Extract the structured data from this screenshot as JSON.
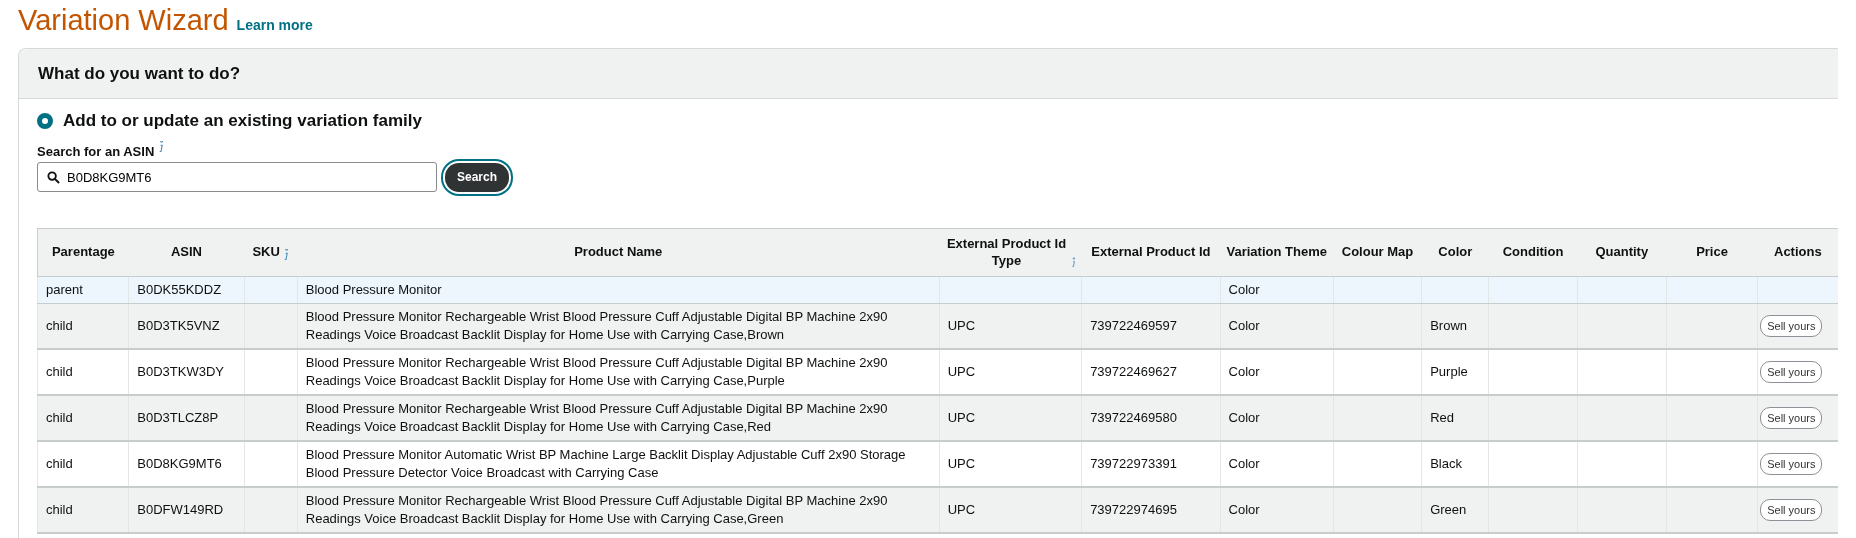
{
  "page": {
    "title": "Variation Wizard",
    "learn_more": "Learn more"
  },
  "panel": {
    "heading": "What do you want to do?"
  },
  "option": {
    "label": "Add to or update an existing variation family",
    "selected": true
  },
  "search": {
    "label": "Search for an ASIN",
    "value": "B0D8KG9MT6",
    "button": "Search",
    "button_focused": true
  },
  "table": {
    "columns": [
      {
        "label": "Parentage",
        "info": false
      },
      {
        "label": "ASIN",
        "info": false
      },
      {
        "label": "SKU",
        "info": true
      },
      {
        "label": "Product Name",
        "info": false
      },
      {
        "label": "External Product Id Type",
        "info": true
      },
      {
        "label": "External Product Id",
        "info": false
      },
      {
        "label": "Variation Theme",
        "info": false
      },
      {
        "label": "Colour Map",
        "info": false
      },
      {
        "label": "Color",
        "info": false
      },
      {
        "label": "Condition",
        "info": false
      },
      {
        "label": "Quantity",
        "info": false
      },
      {
        "label": "Price",
        "info": false
      },
      {
        "label": "Actions",
        "info": false
      }
    ],
    "rows": [
      {
        "highlighted": true,
        "parentage": "parent",
        "asin": "B0DK55KDDZ",
        "product_name": "Blood Pressure Monitor",
        "variation_theme": "Color"
      },
      {
        "highlighted": false,
        "parentage": "child",
        "asin": "B0D3TK5VNZ",
        "product_name": "Blood Pressure Monitor Rechargeable Wrist Blood Pressure Cuff Adjustable Digital BP Machine 2x90 Readings Voice Broadcast Backlit Display for Home Use with Carrying Case,Brown",
        "id_type": "UPC",
        "product_id": "739722469597",
        "variation_theme": "Color",
        "color_name": "Brown",
        "action": "Sell yours"
      },
      {
        "highlighted": false,
        "parentage": "child",
        "asin": "B0D3TKW3DY",
        "product_name": "Blood Pressure Monitor Rechargeable Wrist Blood Pressure Cuff Adjustable Digital BP Machine 2x90 Readings Voice Broadcast Backlit Display for Home Use with Carrying Case,Purple",
        "id_type": "UPC",
        "product_id": "739722469627",
        "variation_theme": "Color",
        "color_name": "Purple",
        "action": "Sell yours"
      },
      {
        "highlighted": false,
        "parentage": "child",
        "asin": "B0D3TLCZ8P",
        "product_name": "Blood Pressure Monitor Rechargeable Wrist Blood Pressure Cuff Adjustable Digital BP Machine 2x90 Readings Voice Broadcast Backlit Display for Home Use with Carrying Case,Red",
        "id_type": "UPC",
        "product_id": "739722469580",
        "variation_theme": "Color",
        "color_name": "Red",
        "action": "Sell yours"
      },
      {
        "highlighted": false,
        "parentage": "child",
        "asin": "B0D8KG9MT6",
        "product_name": "Blood Pressure Monitor Automatic Wrist BP Machine Large Backlit Display Adjustable Cuff 2x90 Storage Blood Pressure Detector Voice Broadcast with Carrying Case",
        "id_type": "UPC",
        "product_id": "739722973391",
        "variation_theme": "Color",
        "color_name": "Black",
        "action": "Sell yours"
      },
      {
        "highlighted": false,
        "parentage": "child",
        "asin": "B0DFW149RD",
        "product_name": "Blood Pressure Monitor Rechargeable Wrist Blood Pressure Cuff Adjustable Digital BP Machine 2x90 Readings Voice Broadcast Backlit Display for Home Use with Carrying Case,Green",
        "id_type": "UPC",
        "product_id": "739722974695",
        "variation_theme": "Color",
        "color_name": "Green",
        "action": "Sell yours"
      }
    ]
  }
}
